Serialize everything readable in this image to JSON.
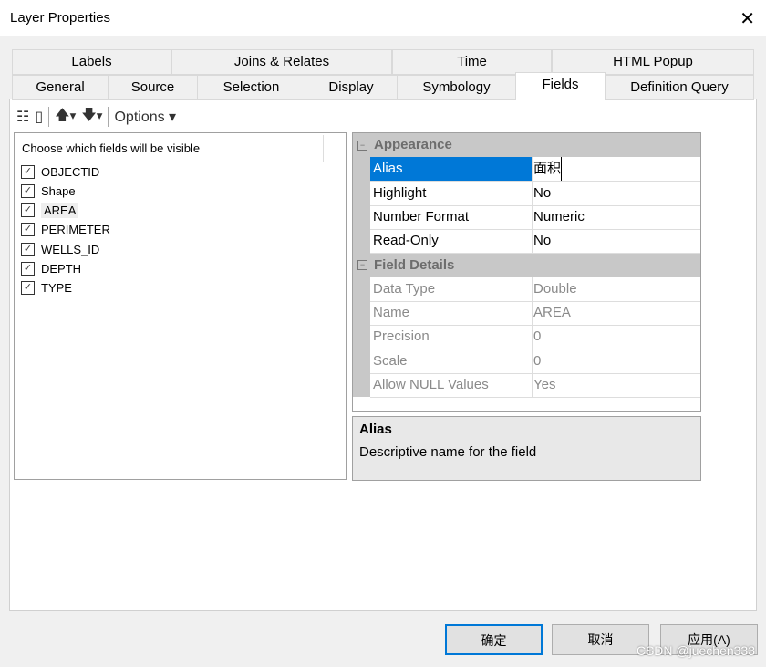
{
  "window": {
    "title": "Layer Properties"
  },
  "tabs_row1": [
    "Labels",
    "Joins & Relates",
    "Time",
    "HTML Popup"
  ],
  "tabs_row2": [
    "General",
    "Source",
    "Selection",
    "Display",
    "Symbology",
    "Fields",
    "Definition Query"
  ],
  "toolbar": {
    "options_label": "Options"
  },
  "fields_list": {
    "header": "Choose which fields will be visible",
    "items": [
      {
        "name": "OBJECTID",
        "checked": true
      },
      {
        "name": "Shape",
        "checked": true
      },
      {
        "name": "AREA",
        "checked": true
      },
      {
        "name": "PERIMETER",
        "checked": true
      },
      {
        "name": "WELLS_ID",
        "checked": true
      },
      {
        "name": "DEPTH",
        "checked": true
      },
      {
        "name": "TYPE",
        "checked": true
      }
    ]
  },
  "properties": {
    "appearance": {
      "label": "Appearance",
      "rows": [
        {
          "k": "Alias",
          "v": "面积"
        },
        {
          "k": "Highlight",
          "v": "No"
        },
        {
          "k": "Number Format",
          "v": "Numeric"
        },
        {
          "k": "Read-Only",
          "v": "No"
        }
      ]
    },
    "details": {
      "label": "Field Details",
      "rows": [
        {
          "k": "Data Type",
          "v": "Double"
        },
        {
          "k": "Name",
          "v": "AREA"
        },
        {
          "k": "Precision",
          "v": "0"
        },
        {
          "k": "Scale",
          "v": "0"
        },
        {
          "k": "Allow NULL Values",
          "v": "Yes"
        }
      ]
    }
  },
  "description": {
    "title": "Alias",
    "text": "Descriptive name for the field"
  },
  "buttons": {
    "ok": "确定",
    "cancel": "取消",
    "apply": "应用(A)"
  },
  "watermark": "CSDN @juechen333",
  "colors": {
    "selection": "#0078d7"
  }
}
